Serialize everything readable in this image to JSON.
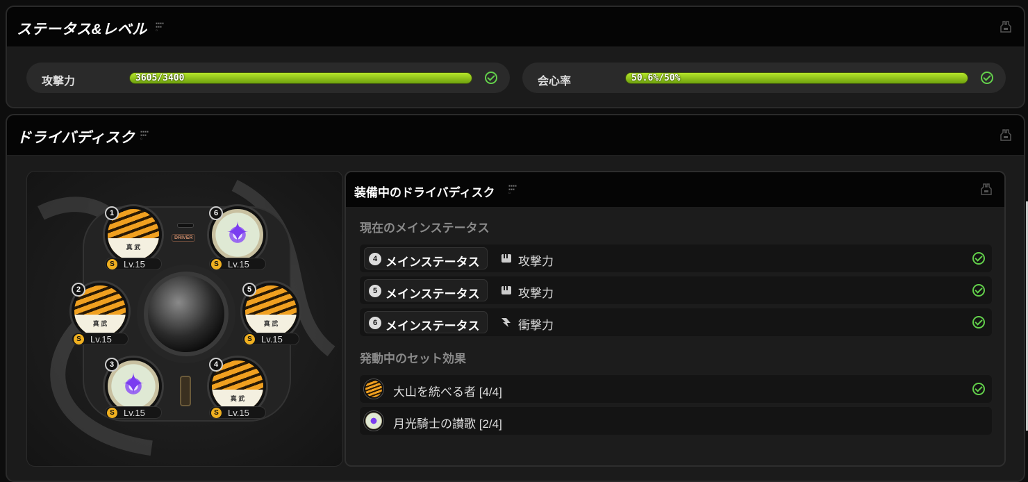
{
  "status_panel": {
    "title": "ステータス&レベル",
    "stats": [
      {
        "label": "攻撃力",
        "value": "3605/3400",
        "met": true
      },
      {
        "label": "会心率",
        "value": "50.6%/50%",
        "met": true
      }
    ]
  },
  "disk_panel": {
    "title": "ドライバディスク",
    "driver_tag": "DRIVER",
    "discs": [
      {
        "num": "1",
        "rank": "S",
        "level": "Lv.15",
        "type": "tiger"
      },
      {
        "num": "6",
        "rank": "S",
        "level": "Lv.15",
        "type": "star"
      },
      {
        "num": "2",
        "rank": "S",
        "level": "Lv.15",
        "type": "tiger"
      },
      {
        "num": "5",
        "rank": "S",
        "level": "Lv.15",
        "type": "tiger"
      },
      {
        "num": "3",
        "rank": "S",
        "level": "Lv.15",
        "type": "star"
      },
      {
        "num": "4",
        "rank": "S",
        "level": "Lv.15",
        "type": "tiger"
      }
    ],
    "equipped": {
      "title": "装備中のドライバディスク",
      "main_section_label": "現在のメインステータス",
      "main_stats": [
        {
          "slot": "4",
          "label": "メインステータス",
          "stat": "攻撃力",
          "met": true
        },
        {
          "slot": "5",
          "label": "メインステータス",
          "stat": "攻撃力",
          "met": true
        },
        {
          "slot": "6",
          "label": "メインステータス",
          "stat": "衝撃力",
          "met": true
        }
      ],
      "set_section_label": "発動中のセット効果",
      "sets": [
        {
          "name": "大山を統べる者 [4/4]",
          "icon": "tiger",
          "met": true
        },
        {
          "name": "月光騎士の讃歌 [2/4]",
          "icon": "star",
          "met": false
        }
      ]
    }
  },
  "colors": {
    "accent_green": "#63d04b",
    "bar_green": "#9ccc1a",
    "disc_orange": "#f0a020"
  }
}
